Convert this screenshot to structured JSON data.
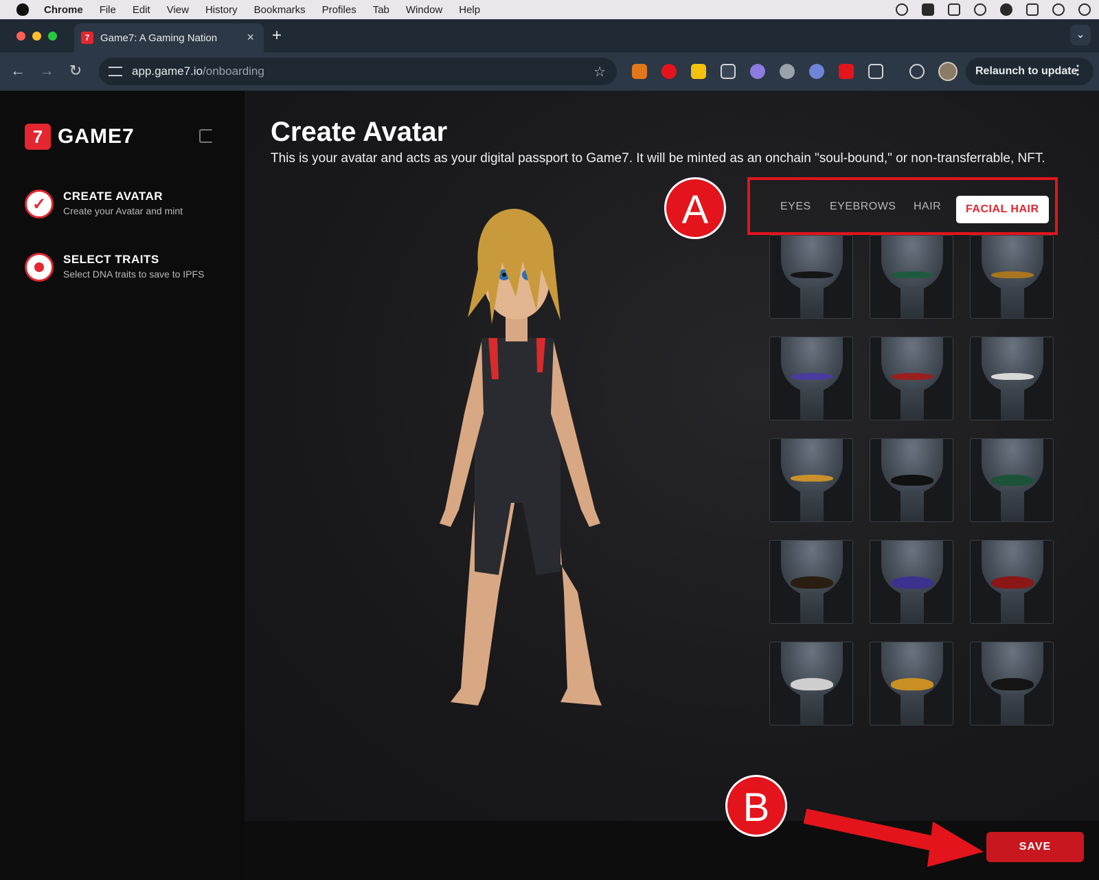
{
  "menubar": {
    "app": "Chrome",
    "items": [
      "File",
      "Edit",
      "View",
      "History",
      "Bookmarks",
      "Profiles",
      "Tab",
      "Window",
      "Help"
    ]
  },
  "browser": {
    "tab_title": "Game7: A Gaming Nation",
    "url_host": "app.game7.io",
    "url_path": "/onboarding",
    "relaunch_label": "Relaunch to update"
  },
  "sidebar": {
    "brand": "GAME7",
    "steps": [
      {
        "title": "CREATE AVATAR",
        "subtitle": "Create your Avatar and mint",
        "state": "done"
      },
      {
        "title": "SELECT TRAITS",
        "subtitle": "Select DNA traits to save to IPFS",
        "state": "current"
      }
    ]
  },
  "main": {
    "title": "Create Avatar",
    "subtitle": "This is your avatar and acts as your digital passport to Game7. It will be minted as an onchain \"soul-bound,\" or non-transferrable, NFT.",
    "trait_tabs": [
      {
        "label": "EYES",
        "active": false
      },
      {
        "label": "EYEBROWS",
        "active": false
      },
      {
        "label": "HAIR",
        "active": false
      },
      {
        "label": "FACIAL HAIR",
        "active": true
      }
    ],
    "options": [
      {
        "name": "mustache-1",
        "color": "#151515"
      },
      {
        "name": "mustache-2",
        "color": "#1f5a3e"
      },
      {
        "name": "mustache-3",
        "color": "#a8761f"
      },
      {
        "name": "mustache-4",
        "color": "#4a3b9e"
      },
      {
        "name": "mustache-5",
        "color": "#9a1f1f"
      },
      {
        "name": "mustache-6",
        "color": "#d8d8d8"
      },
      {
        "name": "mustache-7",
        "color": "#c9902c"
      },
      {
        "name": "mustache-8",
        "color": "#111111"
      },
      {
        "name": "mustache-9",
        "color": "#1c5238"
      },
      {
        "name": "mustache-10",
        "color": "#2a1e12"
      },
      {
        "name": "mustache-11",
        "color": "#3d3190"
      },
      {
        "name": "mustache-12",
        "color": "#8b1616"
      },
      {
        "name": "mustache-13",
        "color": "#cfcfcf"
      },
      {
        "name": "mustache-14",
        "color": "#c98f22"
      },
      {
        "name": "mustache-15",
        "color": "#141414"
      }
    ],
    "save_label": "SAVE"
  },
  "annotations": {
    "a": "A",
    "b": "B"
  },
  "colors": {
    "accent": "#e3262f",
    "annotation": "#e3141c"
  }
}
